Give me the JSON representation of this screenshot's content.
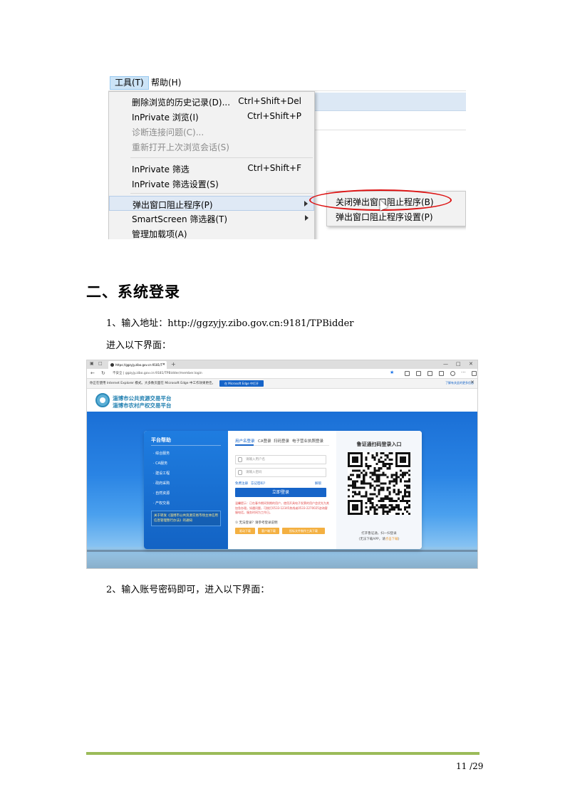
{
  "ie_menu": {
    "menubar": {
      "tools": "工具(T)",
      "help": "帮助(H)"
    },
    "items": [
      {
        "label": "删除浏览的历史记录(D)...",
        "shortcut": "Ctrl+Shift+Del"
      },
      {
        "label": "InPrivate 浏览(I)",
        "shortcut": "Ctrl+Shift+P"
      },
      {
        "label": "诊断连接问题(C)...",
        "shortcut": ""
      },
      {
        "label": "重新打开上次浏览会话(S)",
        "shortcut": ""
      },
      {
        "label": "InPrivate 筛选",
        "shortcut": "Ctrl+Shift+F"
      },
      {
        "label": "InPrivate 筛选设置(S)",
        "shortcut": ""
      },
      {
        "label": "弹出窗口阻止程序(P)",
        "shortcut": ""
      },
      {
        "label": "SmartScreen 筛选器(T)",
        "shortcut": ""
      },
      {
        "label": "管理加载项(A)",
        "shortcut": ""
      }
    ],
    "submenu": [
      {
        "label": "关闭弹出窗口阻止程序(B)"
      },
      {
        "label": "弹出窗口阻止程序设置(P)"
      }
    ],
    "highlight_color": "#d11111"
  },
  "doc": {
    "section_title": "二、系统登录",
    "para1": "1、输入地址：http://ggzyjy.zibo.gov.cn:9181/TPBidder",
    "para2": "进入以下界面：",
    "para3": "2、输入账号密码即可，进入以下界面：",
    "page_number": "11 /29"
  },
  "browser": {
    "tab_title": "https://ggzyjy.zibo.gov.cn:9181/T",
    "url": "不安全 | ggzyjy.zibo.gov.cn:9181/TPBidder/member.login",
    "infobar_text": "你正在使用 Internet Explorer 模式。大多数页面在 Microsoft Edge 中工作效果更佳。",
    "infobar_button": "在 Microsoft Edge 中打开",
    "infobar_link": "了解有关此的更多信息",
    "site_title1": "淄博市公共资源交易平台",
    "site_title2": "淄博市农村产权交易平台",
    "help_title": "平台帮助",
    "help_items": [
      "· 综合服务",
      "· CA服务",
      "· 建设工程",
      "· 政府采购",
      "· 自然资源",
      "· 产权交易"
    ],
    "help_banner": "关于转发《淄博市公共资源交易市场主体信用信息管理暂行办法》的通知",
    "login_tabs": [
      "用户名登录",
      "CA登录",
      "扫码登录",
      "电子营业执照登录"
    ],
    "username_placeholder": "请输入用户名",
    "password_placeholder": "请输入密码",
    "register_link": "免费注册",
    "forgot_link": "忘记密码?",
    "unlock_link": "解锁",
    "login_button": "立即登录",
    "notice": "温馨提示：已在春节期间到期的用户，使用开具电子发票的用户会优先为其加急办理。如遇问题，可拨打0533-12345热线或0533-2270025咨询客服电话，服务时间为工作日。",
    "help_question": "① 无法登录？请参考登录说明",
    "download_buttons": [
      "驱动下载",
      "客户端下载",
      "投标文件制作工具下载"
    ],
    "qr_title": "鲁证通扫码登录入口",
    "qr_hint1": "打开鲁证通，扫一扫登录",
    "qr_hint2_prefix": "(无法下载APP，请",
    "qr_hint2_link": "点击下载",
    "qr_hint2_suffix": ")"
  }
}
